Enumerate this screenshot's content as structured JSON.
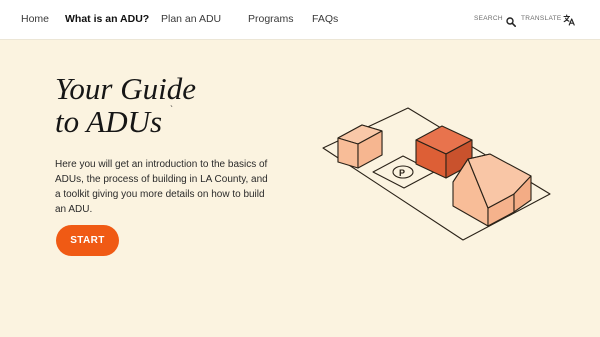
{
  "nav": {
    "items": [
      {
        "label": "Home",
        "active": false
      },
      {
        "label": "What is an ADU?",
        "active": true
      },
      {
        "label": "Plan an ADU",
        "active": false
      },
      {
        "label": "Programs",
        "active": false
      },
      {
        "label": "FAQs",
        "active": false
      }
    ],
    "search_label": "SEARCH",
    "translate_label": "TRANSLATE",
    "search_icon": "search-icon",
    "translate_icon": "translate-icon"
  },
  "hero": {
    "title_line1": "Your Guide",
    "title_line2": "to ADUs",
    "title_mark": "`",
    "description": "Here you will get an introduction to the basics of ADUs, the process of building in LA County, and a toolkit giving you more details on how to build an ADU.",
    "start_label": "START"
  },
  "illustration": {
    "parking_letter": "P",
    "colors": {
      "light_box": "#f8bd98",
      "dark_box": "#e0613a",
      "outline": "#2a2218",
      "background": "#fbf3e0",
      "accent": "#f05a14"
    }
  }
}
